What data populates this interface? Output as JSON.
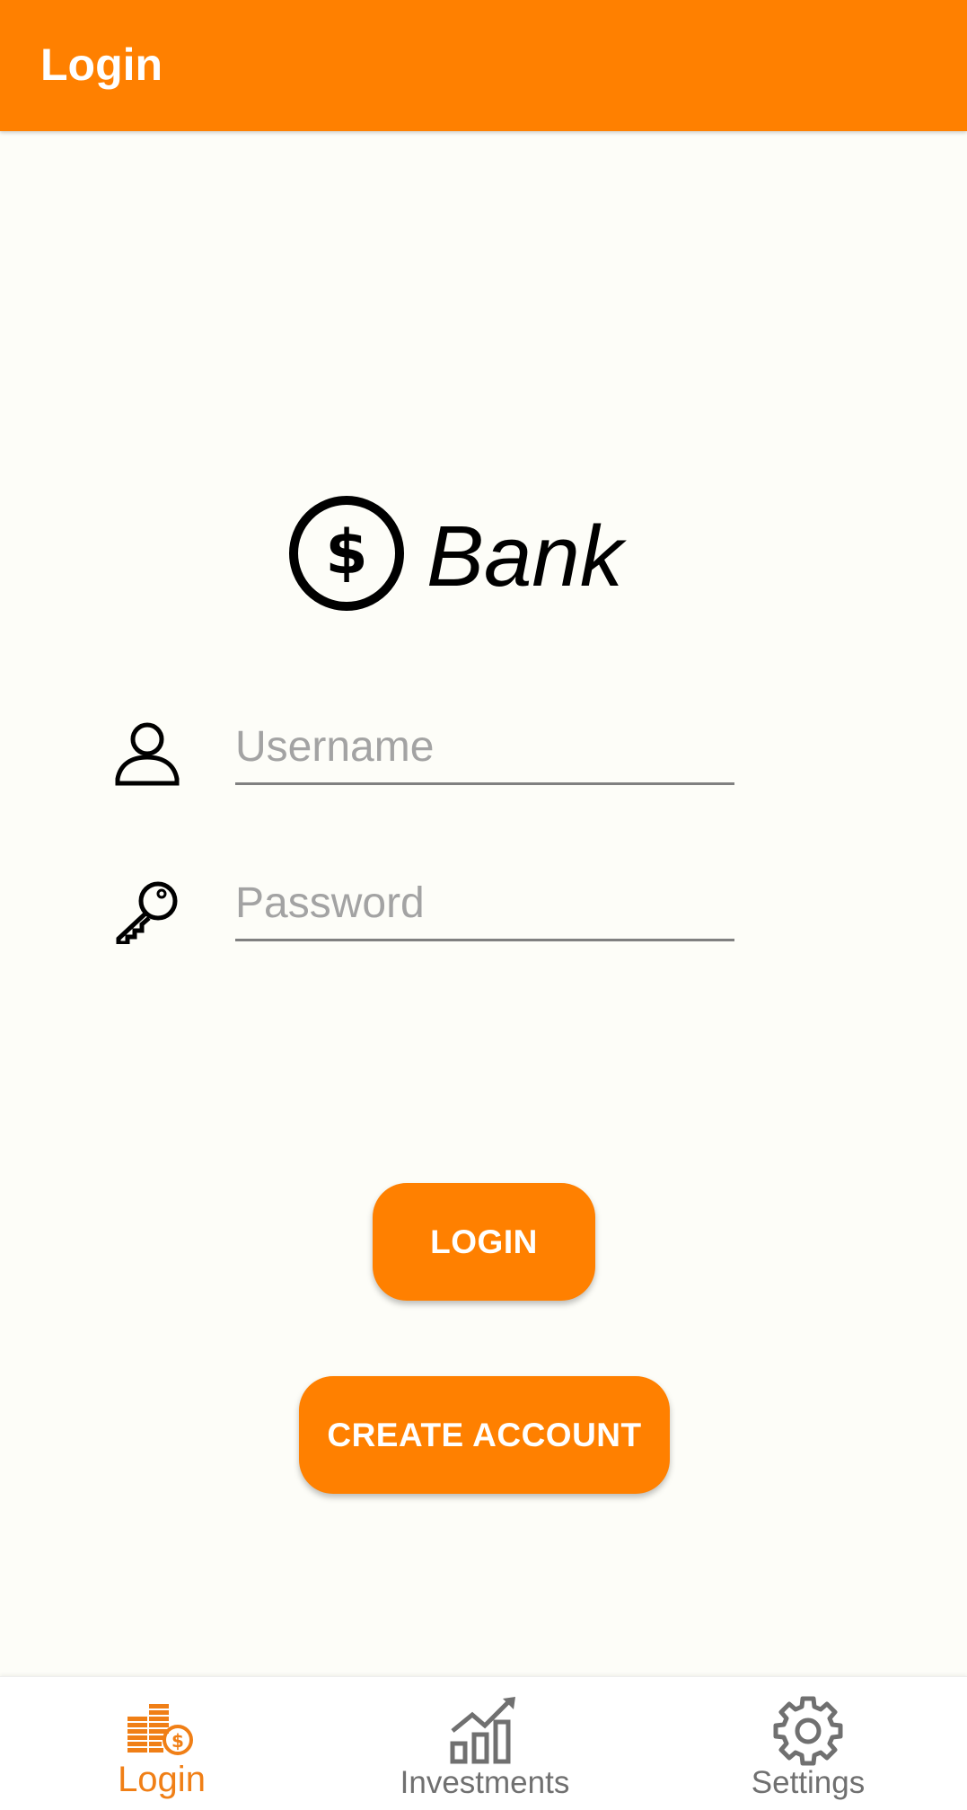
{
  "app_bar": {
    "title": "Login",
    "color": "#ff8000"
  },
  "logo": {
    "icon": "dollar-circle-icon",
    "text": "Bank"
  },
  "form": {
    "username": {
      "icon": "person-icon",
      "placeholder": "Username",
      "value": ""
    },
    "password": {
      "icon": "key-icon",
      "placeholder": "Password",
      "value": ""
    }
  },
  "buttons": {
    "login": "LOGIN",
    "create_account": "CREATE ACCOUNT"
  },
  "bottom_nav": {
    "active_color": "#f07f16",
    "items": [
      {
        "label": "Login",
        "icon": "coins-icon",
        "active": true
      },
      {
        "label": "Investments",
        "icon": "chart-icon",
        "active": false
      },
      {
        "label": "Settings",
        "icon": "gear-icon",
        "active": false
      }
    ]
  }
}
